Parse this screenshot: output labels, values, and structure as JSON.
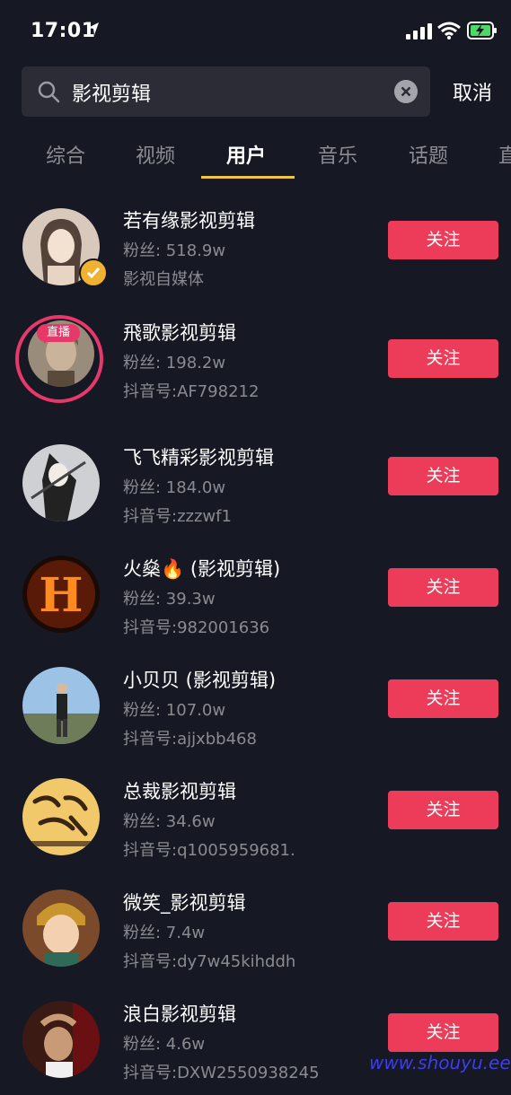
{
  "status_bar": {
    "time": "17:01"
  },
  "search": {
    "query": "影视剪辑",
    "cancel_label": "取消"
  },
  "tabs": [
    {
      "label": "综合"
    },
    {
      "label": "视频"
    },
    {
      "label": "用户"
    },
    {
      "label": "音乐"
    },
    {
      "label": "话题"
    },
    {
      "label": "直"
    }
  ],
  "users": [
    {
      "name": "若有缘影视剪辑",
      "fans": "粉丝: 518.9w",
      "sub": "影视自媒体",
      "verified": true,
      "follow": "关注"
    },
    {
      "name": "飛歌影视剪辑",
      "fans": "粉丝: 198.2w",
      "sub": "抖音号:AF798212",
      "live": "直播",
      "follow": "关注"
    },
    {
      "name": "飞飞精彩影视剪辑",
      "fans": "粉丝: 184.0w",
      "sub": "抖音号:zzzwf1",
      "follow": "关注"
    },
    {
      "name": "火燊🔥 (影视剪辑)",
      "fans": "粉丝: 39.3w",
      "sub": "抖音号:982001636",
      "follow": "关注"
    },
    {
      "name": "小贝贝 (影视剪辑)",
      "fans": "粉丝: 107.0w",
      "sub": "抖音号:ajjxbb468",
      "follow": "关注"
    },
    {
      "name": "总裁影视剪辑",
      "fans": "粉丝: 34.6w",
      "sub": "抖音号:q1005959681.",
      "follow": "关注"
    },
    {
      "name": "微笑_影视剪辑",
      "fans": "粉丝: 7.4w",
      "sub": "抖音号:dy7w45kihddh",
      "follow": "关注"
    },
    {
      "name": "浪白影视剪辑",
      "fans": "粉丝: 4.6w",
      "sub": "抖音号:DXW2550938245",
      "follow": "关注"
    }
  ],
  "watermark": "www.shouyu.ee",
  "colors": {
    "background": "#161823",
    "follow_button": "#ec3c5a",
    "tab_underline": "#f2c342",
    "live_ring": "#e8386a"
  }
}
